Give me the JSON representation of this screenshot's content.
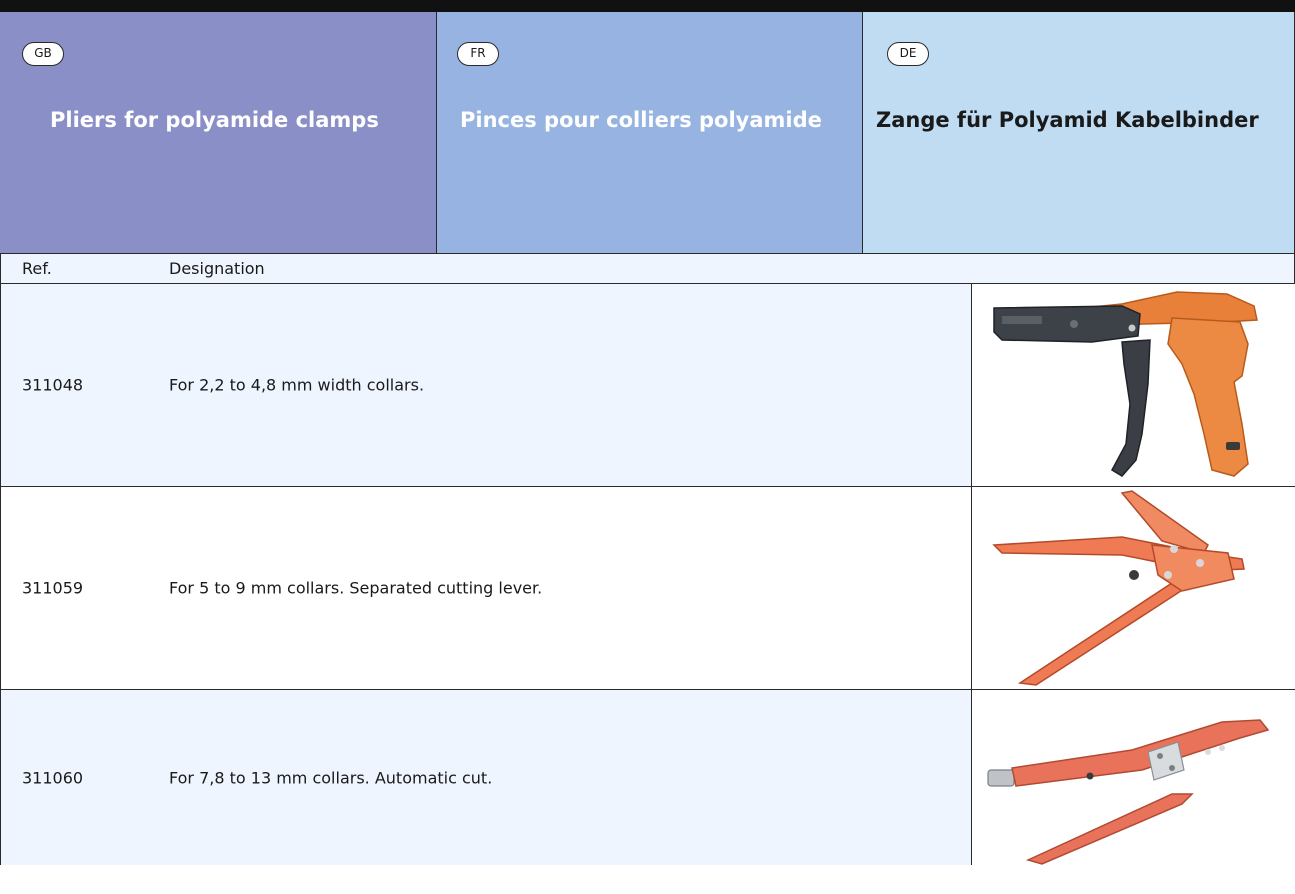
{
  "header": {
    "columns": [
      {
        "lang": "GB",
        "title": "Pliers for polyamide clamps",
        "color": "#8a8fc7"
      },
      {
        "lang": "FR",
        "title": "Pinces pour colliers polyamide",
        "color": "#97b3e1"
      },
      {
        "lang": "DE",
        "title": "Zange für Polyamid Kabelbinder",
        "color": "#c0dcf3"
      }
    ]
  },
  "table": {
    "col_ref": "Ref.",
    "col_designation": "Designation",
    "rows": [
      {
        "ref": "311048",
        "designation": "For 2,2 to 4,8 mm width collars.",
        "image_icon": "cable-tie-gun-icon"
      },
      {
        "ref": "311059",
        "designation": "For 5 to 9 mm collars. Separated cutting lever.",
        "image_icon": "tensioning-pliers-icon"
      },
      {
        "ref": "311060",
        "designation": "For 7,8 to 13 mm collars. Automatic cut.",
        "image_icon": "automatic-cut-pliers-icon"
      }
    ]
  }
}
